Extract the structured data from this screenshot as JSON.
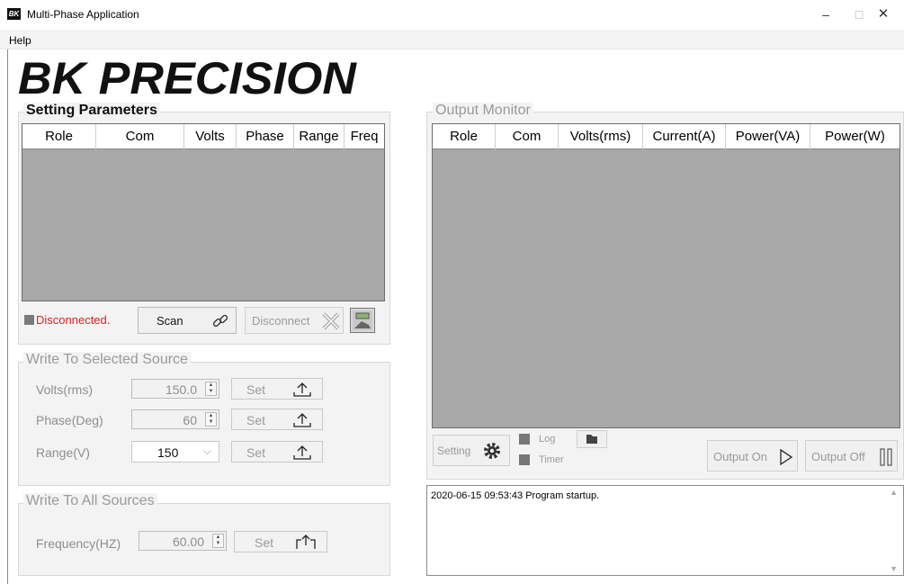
{
  "window": {
    "title": "Multi-Phase Application",
    "min": "–",
    "max": "□",
    "close": "✕"
  },
  "menu": {
    "help": "Help"
  },
  "logo": {
    "text": "BK PRECISION"
  },
  "setting_parameters": {
    "title": "Setting Parameters",
    "columns": [
      "Role",
      "Com",
      "Volts",
      "Phase",
      "Range",
      "Freq"
    ],
    "status": "Disconnected.",
    "scan_label": "Scan",
    "disconnect_label": "Disconnect"
  },
  "write_selected": {
    "title": "Write To Selected Source",
    "volts_label": "Volts(rms)",
    "volts_value": "150.0",
    "phase_label": "Phase(Deg)",
    "phase_value": "60",
    "range_label": "Range(V)",
    "range_value": "150",
    "set_label": "Set"
  },
  "write_all": {
    "title": "Write To All Sources",
    "freq_label": "Frequency(HZ)",
    "freq_value": "60.00",
    "set_label": "Set"
  },
  "output_monitor": {
    "title": "Output Monitor",
    "columns": [
      "Role",
      "Com",
      "Volts(rms)",
      "Current(A)",
      "Power(VA)",
      "Power(W)"
    ],
    "setting_label": "Setting",
    "log_label": "Log",
    "timer_label": "Timer",
    "output_on_label": "Output On",
    "output_off_label": "Output Off"
  },
  "log": {
    "lines": [
      "2020-06-15 09:53:43  Program startup."
    ]
  },
  "colors": {
    "status_red": "#e02020",
    "grid_bg": "#a8a8a8",
    "panel_bg": "#f3f3f3"
  }
}
